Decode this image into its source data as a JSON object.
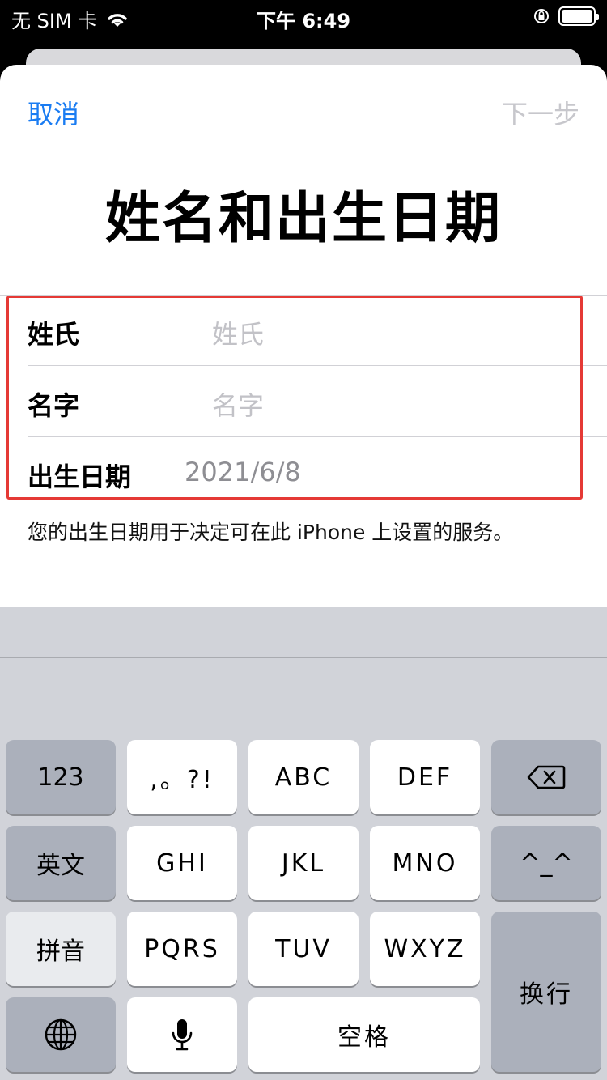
{
  "status_bar": {
    "carrier": "无 SIM 卡",
    "time": "下午 6:49",
    "icons": [
      "wifi-icon",
      "orientation-lock-icon",
      "battery-icon"
    ]
  },
  "nav": {
    "cancel": "取消",
    "next": "下一步"
  },
  "title": "姓名和出生日期",
  "form": {
    "rows": [
      {
        "label": "姓氏",
        "placeholder": "姓氏",
        "value": ""
      },
      {
        "label": "名字",
        "placeholder": "名字",
        "value": ""
      },
      {
        "label": "出生日期",
        "value": "2021/6/8"
      }
    ],
    "footnote": "您的出生日期用于决定可在此 iPhone 上设置的服务。"
  },
  "keyboard": {
    "keys": {
      "num": "123",
      "punct": ",。?!",
      "abc": "ABC",
      "def": "DEF",
      "delete_icon": "backspace-icon",
      "english": "英文",
      "ghi": "GHI",
      "jkl": "JKL",
      "mno": "MNO",
      "emoticon": "^_^",
      "pinyin": "拼音",
      "pqrs": "PQRS",
      "tuv": "TUV",
      "wxyz": "WXYZ",
      "return": "换行",
      "globe_icon": "globe-icon",
      "mic_icon": "microphone-icon",
      "space": "空格"
    }
  },
  "colors": {
    "accent": "#1a7cf2",
    "highlight": "#e53935",
    "placeholder": "#c2c2c7"
  }
}
